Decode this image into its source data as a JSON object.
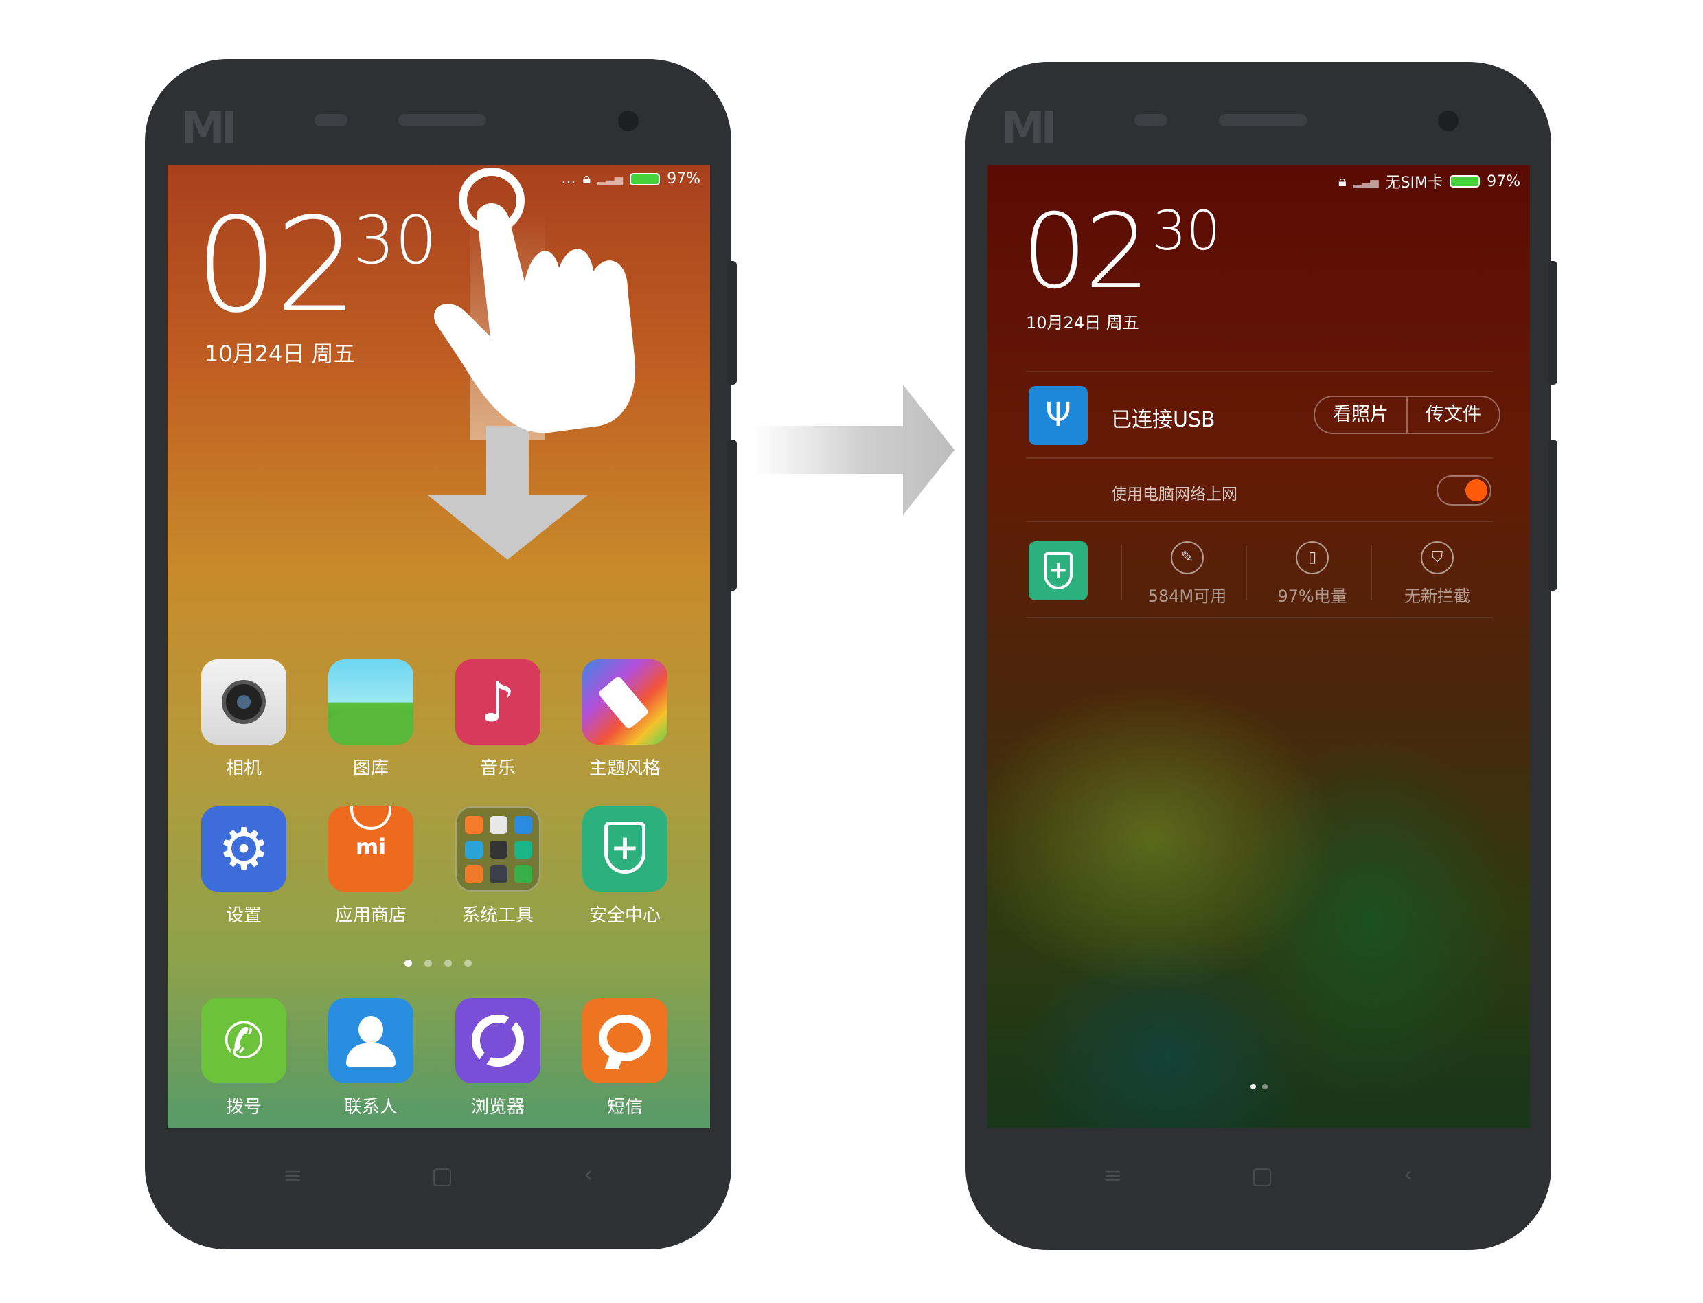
{
  "left_phone": {
    "status": {
      "more": "...",
      "battery": "97%"
    },
    "clock": {
      "hours": "02",
      "minutes": "30"
    },
    "date": "10月24日 周五",
    "apps_row1": [
      {
        "label": "相机",
        "icon": "camera-icon"
      },
      {
        "label": "图库",
        "icon": "gallery-icon"
      },
      {
        "label": "音乐",
        "icon": "music-icon"
      },
      {
        "label": "主题风格",
        "icon": "theme-brush-icon"
      }
    ],
    "apps_row2": [
      {
        "label": "设置",
        "icon": "gear-icon"
      },
      {
        "label": "应用商店",
        "icon": "mi-store-icon"
      },
      {
        "label": "系统工具",
        "icon": "folder-tools-icon"
      },
      {
        "label": "安全中心",
        "icon": "shield-plus-icon"
      }
    ],
    "dock": [
      {
        "label": "拨号",
        "icon": "phone-icon"
      },
      {
        "label": "联系人",
        "icon": "contacts-icon"
      },
      {
        "label": "浏览器",
        "icon": "browser-icon"
      },
      {
        "label": "短信",
        "icon": "message-icon"
      }
    ],
    "page_dots": 4,
    "active_page": 1,
    "logo": "MI"
  },
  "right_phone": {
    "status": {
      "carrier": "无SIM卡",
      "battery": "97%"
    },
    "clock": {
      "hours": "02",
      "minutes": "30"
    },
    "date": "10月24日 周五",
    "usb_notification": {
      "title": "已连接USB",
      "btn_photos": "看照片",
      "btn_files": "传文件",
      "tether_label": "使用电脑网络上网",
      "tether_on": true
    },
    "security_stats": [
      {
        "text": "584M可用",
        "icon": "broom-icon"
      },
      {
        "text": "97%电量",
        "icon": "battery-icon"
      },
      {
        "text": "无新拦截",
        "icon": "shield-block-icon"
      }
    ],
    "page_dots": 2,
    "active_page": 1,
    "logo": "MI"
  },
  "colors": {
    "phone_body": "#2e3033",
    "usb_icon_bg": "#1e88d8",
    "security_icon_bg": "#2bb07e",
    "toggle_knob": "#ff5a0a",
    "battery_fill": "#47d13b"
  }
}
